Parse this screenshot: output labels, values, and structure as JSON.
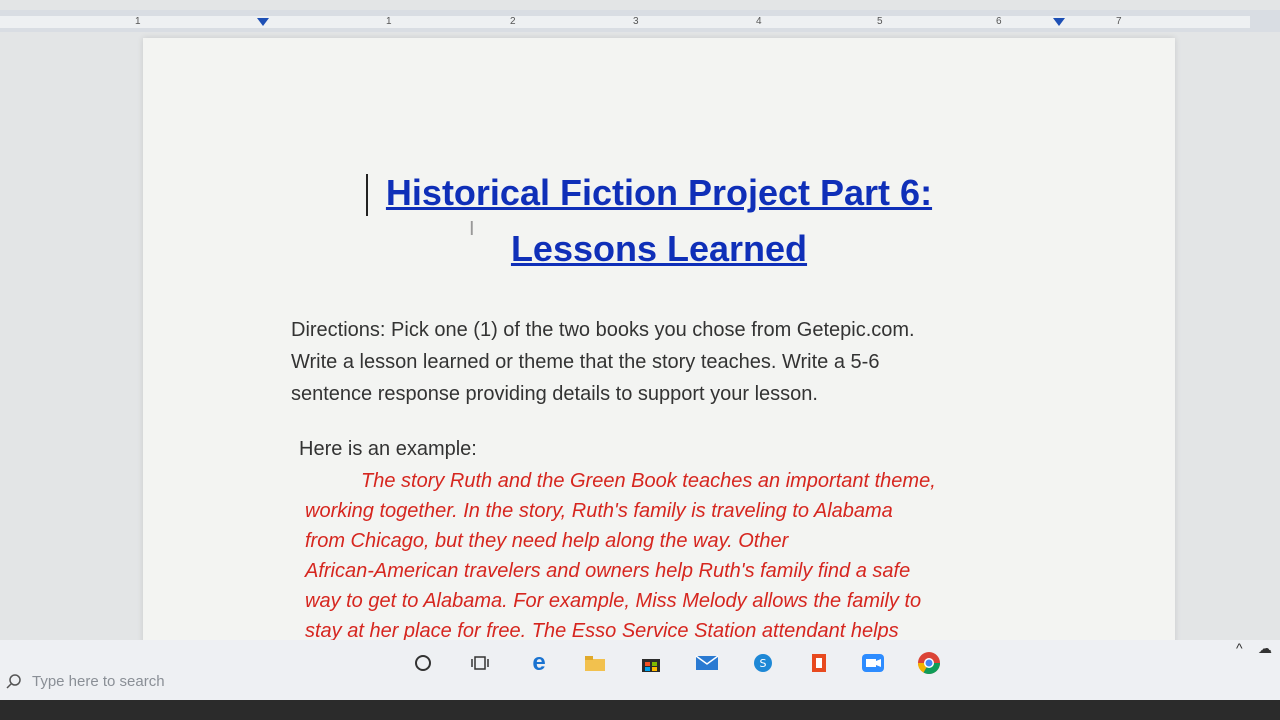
{
  "ruler": {
    "numbers": [
      "1",
      "1",
      "2",
      "3",
      "4",
      "5",
      "6",
      "7"
    ]
  },
  "document": {
    "title_line1": "Historical Fiction Project Part 6:",
    "title_line2": "Lessons Learned",
    "directions_line1": "Directions: Pick one (1) of the two books you chose from Getepic.com.",
    "directions_line2": "Write a lesson learned or theme that the story teaches.  Write a 5-6",
    "directions_line3": "sentence response providing details to support your lesson.",
    "example_intro": "Here is an example:",
    "example_lines": [
      "The story Ruth and the Green Book teaches an important theme,",
      "working together.  In the story, Ruth's family is traveling to Alabama",
      "from Chicago, but they need help along the way.  Other",
      "African-American travelers and owners help Ruth's family find a safe",
      "way to get to Alabama. For example, Miss Melody allows the family to",
      "stay at her place for free.  The Esso Service Station attendant helps"
    ]
  },
  "colors": {
    "title": "#0f2fb8",
    "example_text": "#d6261f",
    "body_text": "#333333"
  },
  "taskbar": {
    "search_placeholder": "Type here to search",
    "icons": [
      "cortana-icon",
      "task-view-icon",
      "edge-icon",
      "file-explorer-icon",
      "store-icon",
      "mail-icon",
      "skype-icon",
      "office-icon",
      "zoom-icon",
      "chrome-icon"
    ]
  }
}
